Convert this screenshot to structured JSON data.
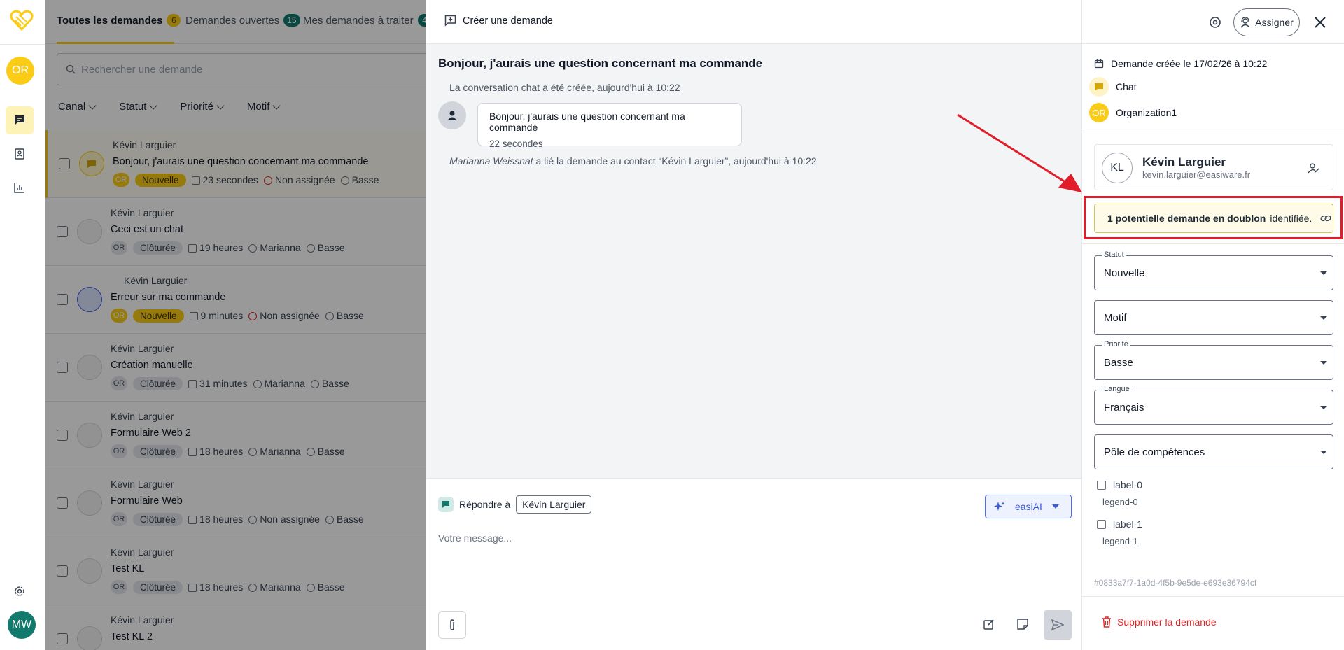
{
  "nav": {
    "user_initials": "OR",
    "agent_initials": "MW"
  },
  "tabs": [
    {
      "label": "Toutes les demandes",
      "count": "6"
    },
    {
      "label": "Demandes ouvertes",
      "count": "15"
    },
    {
      "label": "Mes demandes à traiter",
      "count": "4"
    }
  ],
  "search": {
    "placeholder": "Rechercher une demande"
  },
  "filters": [
    "Canal",
    "Statut",
    "Priorité",
    "Motif"
  ],
  "requests": [
    {
      "name": "Kévin Larguier",
      "title": "Bonjour, j'aurais une question concernant ma commande",
      "org": "OR",
      "status": "Nouvelle",
      "time": "23 secondes",
      "assignee": "Non assignée",
      "priority": "Basse"
    },
    {
      "name": "Kévin Larguier",
      "title": "Ceci est un chat",
      "org": "OR",
      "status": "Clôturée",
      "time": "19 heures",
      "assignee": "Marianna",
      "priority": "Basse"
    },
    {
      "name": "Kévin Larguier",
      "title": "Erreur sur ma commande",
      "org": "OR",
      "status": "Nouvelle",
      "time": "9 minutes",
      "assignee": "Non assignée",
      "priority": "Basse"
    },
    {
      "name": "Kévin Larguier",
      "title": "Création manuelle",
      "org": "OR",
      "status": "Clôturée",
      "time": "31 minutes",
      "assignee": "Marianna",
      "priority": "Basse"
    },
    {
      "name": "Kévin Larguier",
      "title": "Formulaire Web 2",
      "org": "OR",
      "status": "Clôturée",
      "time": "18 heures",
      "assignee": "Marianna",
      "priority": "Basse"
    },
    {
      "name": "Kévin Larguier",
      "title": "Formulaire Web",
      "org": "OR",
      "status": "Clôturée",
      "time": "18 heures",
      "assignee": "Non assignée",
      "priority": "Basse"
    },
    {
      "name": "Kévin Larguier",
      "title": "Test KL",
      "org": "OR",
      "status": "Clôturée",
      "time": "18 heures",
      "assignee": "Marianna",
      "priority": "Basse"
    },
    {
      "name": "Kévin Larguier",
      "title": "Test KL 2",
      "org": "",
      "status": "",
      "time": "",
      "assignee": "",
      "priority": ""
    }
  ],
  "conversation": {
    "create_label": "Créer une demande",
    "title": "Bonjour, j'aurais une question concernant ma commande",
    "system_created": "La conversation chat a été créée, aujourd'hui à 10:22",
    "message_text": "Bonjour, j'aurais une question concernant ma commande",
    "message_time": "22 secondes",
    "link_actor": "Marianna Weissnat",
    "link_text": " a lié la demande au contact “Kévin Larguier”, aujourd'hui à 10:22",
    "reply_label": "Répondre à",
    "reply_to": "Kévin Larguier",
    "ai_label": "easiAI",
    "message_placeholder": "Votre message..."
  },
  "details": {
    "assign_label": "Assigner",
    "created": "Demande créée le 17/02/26 à 10:22",
    "channel": "Chat",
    "org_initials": "OR",
    "organization": "Organization1",
    "contact_initials": "KL",
    "contact_name": "Kévin Larguier",
    "contact_email": "kevin.larguier@easiware.fr",
    "duplicate_bold": "1 potentielle demande en doublon",
    "duplicate_rest": " identifiée.",
    "fields": [
      {
        "label": "Statut",
        "value": "Nouvelle"
      },
      {
        "label": "",
        "value": "Motif"
      },
      {
        "label": "Priorité",
        "value": "Basse"
      },
      {
        "label": "Langue",
        "value": "Français"
      },
      {
        "label": "",
        "value": "Pôle de compétences"
      }
    ],
    "checkboxes": [
      {
        "label": "label-0",
        "legend": "legend-0"
      },
      {
        "label": "label-1",
        "legend": "legend-1"
      }
    ],
    "id": "#0833a7f7-1a0d-4f5b-9e5de-e693e36794cf",
    "delete_label": "Supprimer la demande"
  },
  "colors": {
    "accent": "#facc15",
    "teal": "#117a6d",
    "danger": "#dc2626",
    "annotation": "#e11d2a"
  }
}
